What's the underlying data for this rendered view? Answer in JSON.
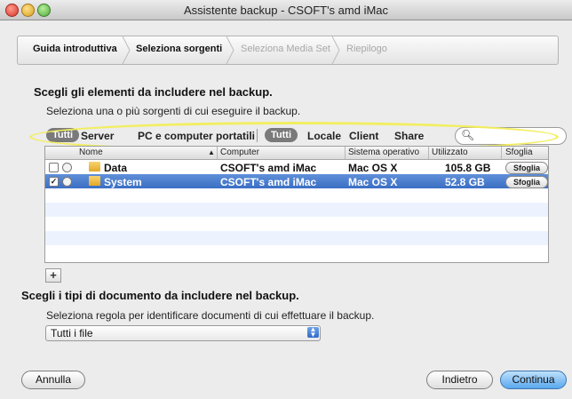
{
  "window": {
    "title": "Assistente backup - CSOFT's amd iMac"
  },
  "steps": [
    {
      "label": "Guida introduttiva",
      "state": "done"
    },
    {
      "label": "Seleziona sorgenti",
      "state": "current"
    },
    {
      "label": "Seleziona Media Set",
      "state": "upcoming"
    },
    {
      "label": "Riepilogo",
      "state": "upcoming"
    }
  ],
  "sources": {
    "heading": "Scegli gli elementi da includere nel backup.",
    "instruction": "Seleziona una o più sorgenti di cui eseguire il backup.",
    "filter_group1": [
      "Tutti",
      "Server",
      "PC e computer portatili"
    ],
    "filter_group2": [
      "Tutti",
      "Locale",
      "Client",
      "Share"
    ],
    "search_placeholder": "",
    "highlight_color": "#f2ee5b",
    "columns": [
      "Nome",
      "Computer",
      "Sistema operativo",
      "Utilizzato",
      "Sfoglia"
    ],
    "rows": [
      {
        "checked": false,
        "name": "Data",
        "computer": "CSOFT's amd iMac",
        "os": "Mac OS X",
        "used": "105.8 GB",
        "browse": "Sfoglia",
        "selected": false
      },
      {
        "checked": true,
        "name": "System",
        "computer": "CSOFT's amd iMac",
        "os": "Mac OS X",
        "used": "52.8 GB",
        "browse": "Sfoglia",
        "selected": true
      }
    ],
    "add_label": "+"
  },
  "doctypes": {
    "heading": "Scegli i tipi di documento da includere nel backup.",
    "instruction": "Seleziona regola per identificare documenti di cui effettuare il backup.",
    "selected_rule": "Tutti i file"
  },
  "buttons": {
    "cancel": "Annulla",
    "back": "Indietro",
    "continue": "Continua"
  },
  "colors": {
    "selection": "#3b6fc4",
    "accent": "#5aa8ee"
  }
}
